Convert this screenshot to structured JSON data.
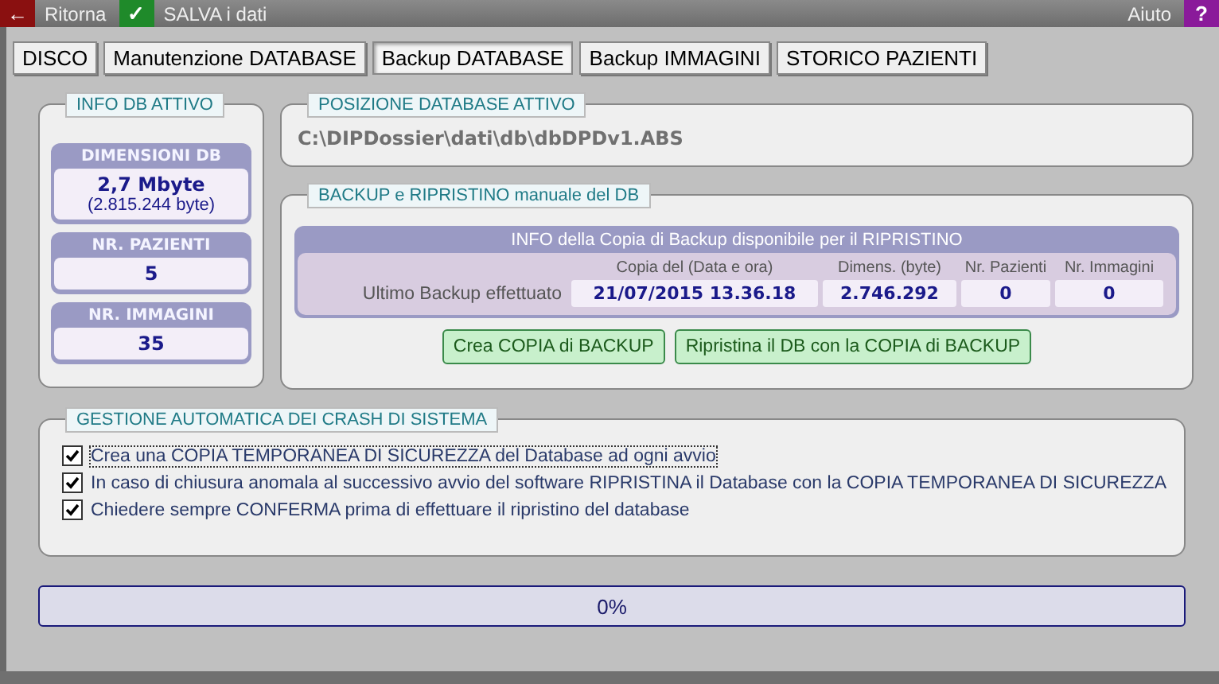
{
  "toolbar": {
    "back": {
      "icon": "←",
      "label": "Ritorna"
    },
    "save": {
      "icon": "✓",
      "label": "SALVA i dati"
    },
    "help": {
      "label": "Aiuto",
      "icon": "?"
    }
  },
  "tabs": [
    {
      "label": "DISCO",
      "selected": false
    },
    {
      "label": "Manutenzione DATABASE",
      "selected": false
    },
    {
      "label": "Backup DATABASE",
      "selected": true
    },
    {
      "label": "Backup IMMAGINI",
      "selected": false
    },
    {
      "label": "STORICO PAZIENTI",
      "selected": false
    }
  ],
  "info_db": {
    "title": "INFO DB ATTIVO",
    "cards": [
      {
        "label": "DIMENSIONI DB",
        "value": "2,7 Mbyte",
        "detail": "(2.815.244 byte)"
      },
      {
        "label": "NR. PAZIENTI",
        "value": "5"
      },
      {
        "label": "NR. IMMAGINI",
        "value": "35"
      }
    ]
  },
  "position": {
    "title": "POSIZIONE DATABASE ATTIVO",
    "path": "C:\\DIPDossier\\dati\\db\\dbDPDv1.ABS"
  },
  "backup": {
    "title": "BACKUP e RIPRISTINO manuale del DB",
    "info_title": "INFO della Copia di Backup disponibile per il RIPRISTINO",
    "row_label": "Ultimo Backup effettuato",
    "columns": [
      {
        "header": "Copia del (Data e ora)",
        "value": "21/07/2015 13.36.18"
      },
      {
        "header": "Dimens. (byte)",
        "value": "2.746.292"
      },
      {
        "header": "Nr. Pazienti",
        "value": "0"
      },
      {
        "header": "Nr. Immagini",
        "value": "0"
      }
    ],
    "buttons": [
      "Crea COPIA di BACKUP",
      "Ripristina il DB con la COPIA di BACKUP"
    ]
  },
  "crash": {
    "title": "GESTIONE AUTOMATICA DEI CRASH DI SISTEMA",
    "options": [
      {
        "label": "Crea una COPIA TEMPORANEA DI SICUREZZA del Database ad ogni avvio",
        "checked": true
      },
      {
        "label": "In caso di chiusura anomala al successivo avvio del software RIPRISTINA il Database con la COPIA TEMPORANEA DI SICUREZZA",
        "checked": true
      },
      {
        "label": "Chiedere sempre CONFERMA prima di effettuare il ripristino del database",
        "checked": true
      }
    ]
  },
  "progress": {
    "label": "0%",
    "level": 0
  }
}
